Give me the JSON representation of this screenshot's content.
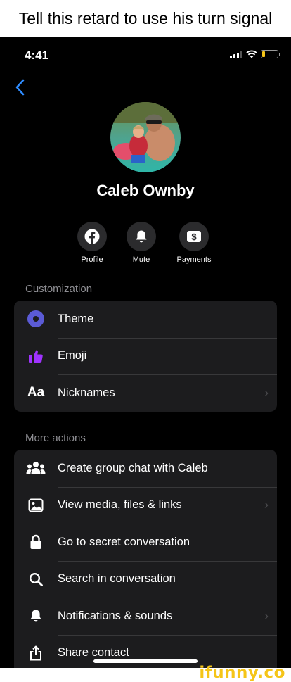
{
  "caption": "Tell this retard to use his turn signal",
  "status_bar": {
    "time": "4:41",
    "battery_level": 0.2
  },
  "contact": {
    "name": "Caleb Ownby"
  },
  "quick_actions": [
    {
      "label": "Profile",
      "icon": "facebook-icon"
    },
    {
      "label": "Mute",
      "icon": "bell-icon"
    },
    {
      "label": "Payments",
      "icon": "dollar-icon"
    }
  ],
  "customization": {
    "title": "Customization",
    "items": [
      {
        "label": "Theme",
        "icon": "theme-icon",
        "chevron": false
      },
      {
        "label": "Emoji",
        "icon": "thumbs-up-icon",
        "chevron": false
      },
      {
        "label": "Nicknames",
        "icon": "aa-icon",
        "icon_text": "Aa",
        "chevron": true
      }
    ]
  },
  "more_actions": {
    "title": "More actions",
    "items": [
      {
        "label": "Create group chat with Caleb",
        "icon": "group-icon",
        "chevron": false
      },
      {
        "label": "View media, files & links",
        "icon": "image-icon",
        "chevron": true
      },
      {
        "label": "Go to secret conversation",
        "icon": "lock-icon",
        "chevron": false
      },
      {
        "label": "Search in conversation",
        "icon": "search-icon",
        "chevron": false
      },
      {
        "label": "Notifications & sounds",
        "icon": "bell-icon",
        "chevron": true
      },
      {
        "label": "Share contact",
        "icon": "share-icon",
        "chevron": false
      }
    ]
  },
  "chevron_glyph": "›",
  "watermark": "ifunny.co",
  "colors": {
    "accent": "#2f8cff",
    "theme": "#5b5bd6",
    "emoji": "#a033ff",
    "watermark": "#f5c518"
  }
}
